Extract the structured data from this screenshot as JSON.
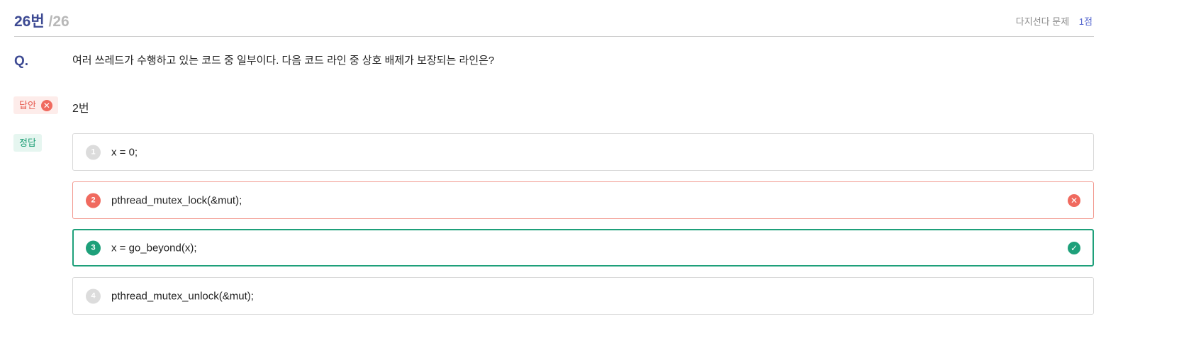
{
  "header": {
    "question_number": "26번",
    "total": "/26",
    "question_type": "다지선다 문제",
    "points": "1점"
  },
  "question": {
    "label": "Q.",
    "text": "여러 쓰레드가 수행하고 있는 코드 중 일부이다. 다음 코드 라인 중 상호 배제가 보장되는 라인은?"
  },
  "answer": {
    "tag_label": "답안",
    "value": "2번",
    "status_icon": "x-circle-icon",
    "status_color": "#f06a5f"
  },
  "correct": {
    "tag_label": "정답",
    "color": "#1ea07a"
  },
  "choices": [
    {
      "number": "1",
      "text": "x = 0;",
      "state": "neutral"
    },
    {
      "number": "2",
      "text": "pthread_mutex_lock(&mut);",
      "state": "wrong",
      "icon": "x-circle-icon"
    },
    {
      "number": "3",
      "text": "x = go_beyond(x);",
      "state": "correct",
      "icon": "check-circle-icon"
    },
    {
      "number": "4",
      "text": "pthread_mutex_unlock(&mut);",
      "state": "neutral"
    }
  ]
}
